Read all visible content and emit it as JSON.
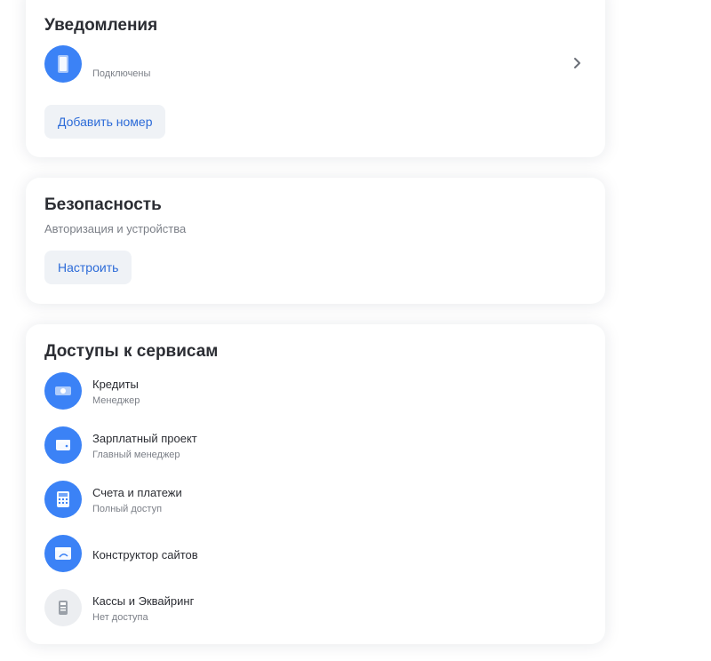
{
  "notifications": {
    "title": "Уведомления",
    "status": "Подключены",
    "add_button": "Добавить номер",
    "icon": "phone-icon"
  },
  "security": {
    "title": "Безопасность",
    "subtitle": "Авторизация и устройства",
    "button": "Настроить"
  },
  "access": {
    "title": "Доступы к сервисам",
    "items": [
      {
        "title": "Кредиты",
        "role": "Менеджер",
        "icon": "money-icon"
      },
      {
        "title": "Зарплатный проект",
        "role": "Главный менеджер",
        "icon": "wallet-icon"
      },
      {
        "title": "Счета и платежи",
        "role": "Полный доступ",
        "icon": "calculator-icon"
      },
      {
        "title": "Конструктор сайтов",
        "role": "",
        "icon": "site-builder-icon"
      },
      {
        "title": "Кассы и Эквайринг",
        "role": "Нет доступа",
        "icon": "cash-register-icon"
      }
    ]
  },
  "colors": {
    "accent": "#3b82f6",
    "button_bg": "#eff2f6",
    "button_text": "#2c6bd8",
    "disabled_icon_bg": "#eceef1"
  }
}
